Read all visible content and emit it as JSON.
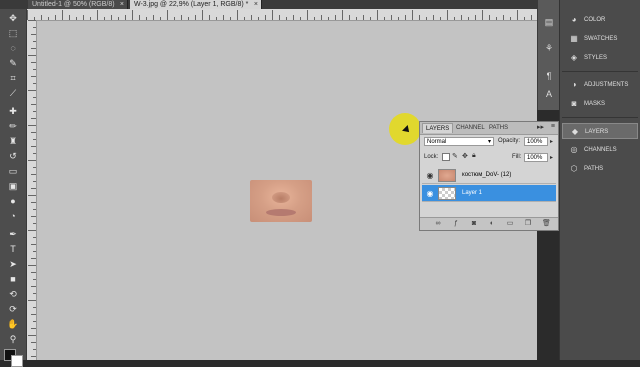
{
  "tabs": [
    {
      "label": "Untitled-1 @ 50% (RGB/8)",
      "active": false
    },
    {
      "label": "W-3.jpg @ 22,9% (Layer 1, RGB/8) *",
      "active": true
    }
  ],
  "tab_close_glyph": "×",
  "toolbox": {
    "icons": [
      "move-icon",
      "marquee-icon",
      "lasso-icon",
      "quick-select-icon",
      "crop-icon",
      "eyedropper-icon",
      "healing-brush-icon",
      "brush-icon",
      "clone-stamp-icon",
      "history-brush-icon",
      "eraser-icon",
      "gradient-icon",
      "blur-icon",
      "dodge-icon",
      "pen-icon",
      "type-icon",
      "path-select-icon",
      "shape-icon",
      "3d-rotate-icon",
      "3d-orbit-icon",
      "hand-icon",
      "zoom-icon"
    ]
  },
  "layers_panel": {
    "tabs": [
      "LAYERS",
      "CHANNEL",
      "PATHS"
    ],
    "blend_mode": "Normal",
    "opacity_label": "Opacity:",
    "opacity_value": "100%",
    "lock_label": "Lock:",
    "fill_label": "Fill:",
    "fill_value": "100%",
    "layers": [
      {
        "name": "костюм_DoV- (12)",
        "selected": false
      },
      {
        "name": "Layer 1",
        "selected": true
      }
    ]
  },
  "right_panels": {
    "group1": [
      {
        "label": "COLOR",
        "icon": "color-icon"
      },
      {
        "label": "SWATCHES",
        "icon": "swatches-icon"
      },
      {
        "label": "STYLES",
        "icon": "styles-icon"
      }
    ],
    "group2": [
      {
        "label": "ADJUSTMENTS",
        "icon": "adjustments-icon"
      },
      {
        "label": "MASKS",
        "icon": "masks-icon"
      }
    ],
    "group3": [
      {
        "label": "LAYERS",
        "icon": "layers-icon",
        "active": true
      },
      {
        "label": "CHANNELS",
        "icon": "channels-icon"
      },
      {
        "label": "PATHS",
        "icon": "paths-icon"
      }
    ]
  },
  "colors": {
    "accent_selected": "#3a90e0",
    "cursor_highlight": "#e6dc14",
    "canvas_bg": "#c3c3c3"
  }
}
